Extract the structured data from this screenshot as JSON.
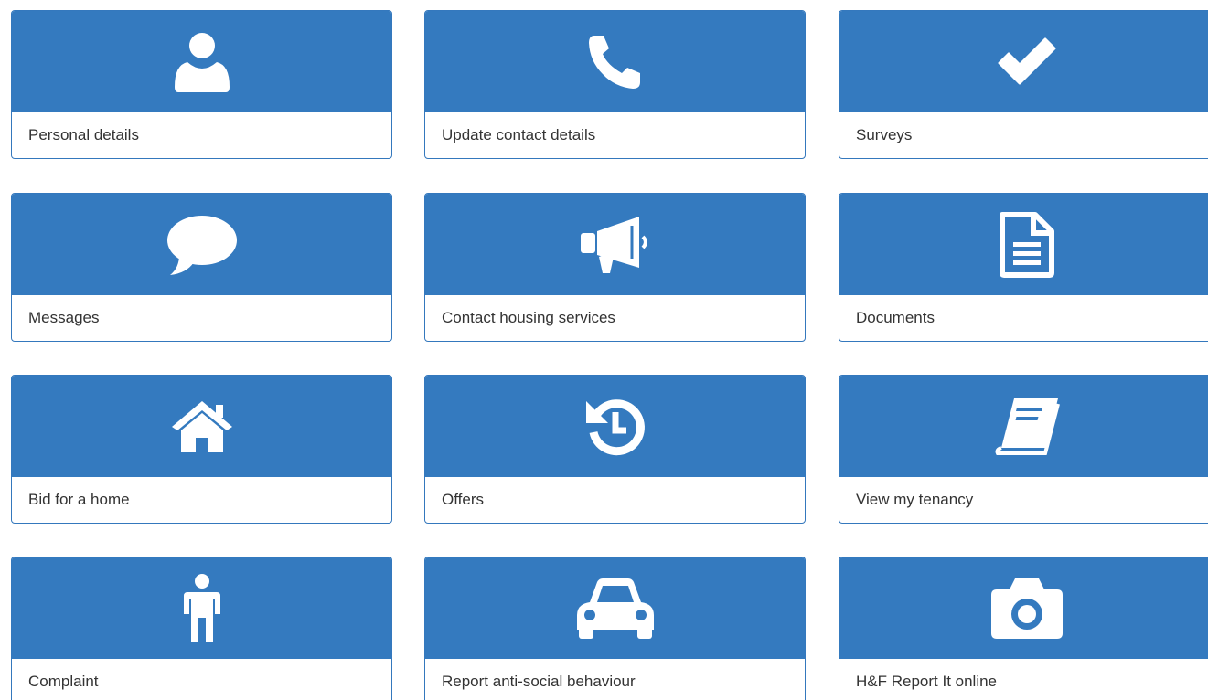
{
  "tiles": [
    {
      "label": "Personal details",
      "icon": "user-icon"
    },
    {
      "label": "Update contact details",
      "icon": "phone-icon"
    },
    {
      "label": "Surveys",
      "icon": "check-icon"
    },
    {
      "label": "Messages",
      "icon": "speech-bubble-icon"
    },
    {
      "label": "Contact housing services",
      "icon": "megaphone-icon"
    },
    {
      "label": "Documents",
      "icon": "document-icon"
    },
    {
      "label": "Bid for a home",
      "icon": "home-icon"
    },
    {
      "label": "Offers",
      "icon": "history-icon"
    },
    {
      "label": "View my tenancy",
      "icon": "book-icon"
    },
    {
      "label": "Complaint",
      "icon": "person-icon"
    },
    {
      "label": "Report anti-social behaviour",
      "icon": "car-icon"
    },
    {
      "label": "H&F Report It online",
      "icon": "camera-icon"
    }
  ],
  "colors": {
    "tile_header": "#347abf",
    "tile_border": "#3478bd",
    "label_text": "#333333",
    "icon": "#ffffff"
  }
}
